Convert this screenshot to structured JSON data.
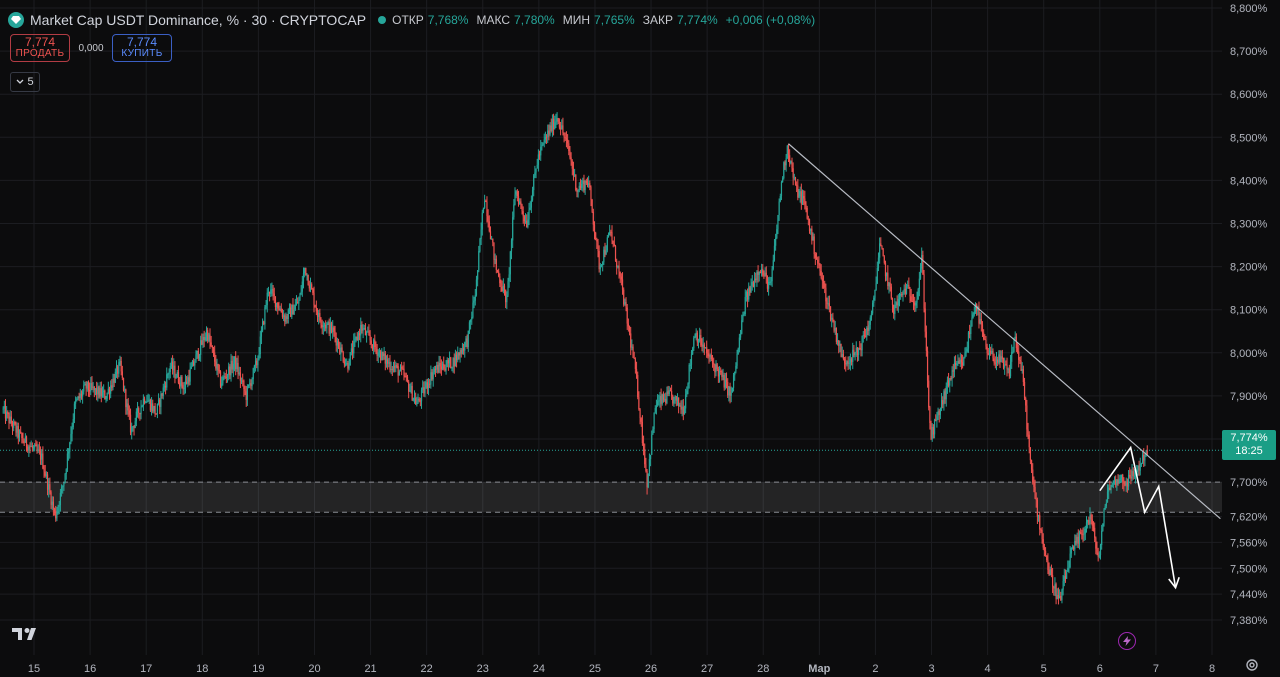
{
  "header": {
    "title": "Market Cap USDT Dominance, % · 30 · CRYPTOCAP",
    "ohlc": [
      {
        "label": "ОТКР",
        "value": "7,768%"
      },
      {
        "label": "МАКС",
        "value": "7,780%"
      },
      {
        "label": "МИН",
        "value": "7,765%"
      },
      {
        "label": "ЗАКР",
        "value": "7,774%"
      }
    ],
    "change": "+0,006 (+0,08%)"
  },
  "trade": {
    "sell_price": "7,774",
    "sell_label": "ПРОДАТЬ",
    "spread": "0,000",
    "buy_price": "7,774",
    "buy_label": "КУПИТЬ"
  },
  "indicators_toggle": {
    "count": "5"
  },
  "price_tag": {
    "value": "7,774%",
    "countdown": "18:25"
  },
  "colors": {
    "background": "#0c0c0d",
    "up": "#26a69a",
    "down": "#ef5350",
    "grid": "#1c1d21",
    "axis_text": "#b2b5be"
  },
  "icons": {
    "logo": "diamond-icon",
    "tradingview": "tradingview-logo",
    "replay": "bolt-icon",
    "settings": "gear-icon"
  },
  "chart_data": {
    "type": "candlestick",
    "title": "Market Cap USDT Dominance, % · 30 · CRYPTOCAP",
    "xlabel": "",
    "ylabel": "",
    "ylim": [
      7.3,
      8.81
    ],
    "grid": true,
    "y_ticks": [
      "8,800%",
      "8,700%",
      "8,600%",
      "8,500%",
      "8,400%",
      "8,300%",
      "8,200%",
      "8,100%",
      "8,000%",
      "7,900%",
      "7,800%",
      "7,700%",
      "7,620%",
      "7,560%",
      "7,500%",
      "7,440%",
      "7,380%"
    ],
    "y_tick_values": [
      8.8,
      8.7,
      8.6,
      8.5,
      8.4,
      8.3,
      8.2,
      8.1,
      8.0,
      7.9,
      7.8,
      7.7,
      7.62,
      7.56,
      7.5,
      7.44,
      7.38
    ],
    "x_ticks": [
      "15",
      "16",
      "17",
      "18",
      "19",
      "20",
      "21",
      "22",
      "23",
      "24",
      "25",
      "26",
      "27",
      "28",
      "Мар",
      "2",
      "3",
      "4",
      "5",
      "6",
      "7",
      "8"
    ],
    "x_tick_index": [
      0,
      1,
      2,
      3,
      4,
      5,
      6,
      7,
      8,
      9,
      10,
      11,
      12,
      13,
      14,
      15,
      16,
      17,
      18,
      19,
      20,
      21
    ],
    "x_range_days": [
      -0.55,
      21.15
    ],
    "price_anchors": [
      [
        -0.55,
        7.87
      ],
      [
        -0.2,
        7.8
      ],
      [
        0.15,
        7.76
      ],
      [
        0.4,
        7.62
      ],
      [
        0.55,
        7.7
      ],
      [
        0.75,
        7.88
      ],
      [
        0.95,
        7.92
      ],
      [
        1.3,
        7.9
      ],
      [
        1.55,
        7.97
      ],
      [
        1.75,
        7.82
      ],
      [
        2.0,
        7.9
      ],
      [
        2.2,
        7.86
      ],
      [
        2.45,
        7.97
      ],
      [
        2.7,
        7.92
      ],
      [
        3.1,
        8.05
      ],
      [
        3.35,
        7.93
      ],
      [
        3.6,
        7.98
      ],
      [
        3.8,
        7.9
      ],
      [
        4.0,
        7.98
      ],
      [
        4.2,
        8.15
      ],
      [
        4.5,
        8.08
      ],
      [
        4.75,
        8.12
      ],
      [
        4.85,
        8.2
      ],
      [
        5.1,
        8.08
      ],
      [
        5.35,
        8.05
      ],
      [
        5.6,
        7.97
      ],
      [
        5.85,
        8.06
      ],
      [
        6.05,
        8.02
      ],
      [
        6.3,
        7.98
      ],
      [
        6.6,
        7.95
      ],
      [
        6.85,
        7.88
      ],
      [
        7.15,
        7.96
      ],
      [
        7.5,
        7.98
      ],
      [
        7.75,
        8.03
      ],
      [
        7.9,
        8.15
      ],
      [
        8.05,
        8.37
      ],
      [
        8.25,
        8.2
      ],
      [
        8.45,
        8.12
      ],
      [
        8.6,
        8.38
      ],
      [
        8.8,
        8.3
      ],
      [
        9.0,
        8.45
      ],
      [
        9.15,
        8.5
      ],
      [
        9.35,
        8.55
      ],
      [
        9.55,
        8.47
      ],
      [
        9.7,
        8.38
      ],
      [
        9.9,
        8.4
      ],
      [
        10.1,
        8.2
      ],
      [
        10.3,
        8.28
      ],
      [
        10.5,
        8.15
      ],
      [
        10.75,
        7.95
      ],
      [
        10.95,
        7.7
      ],
      [
        11.1,
        7.88
      ],
      [
        11.35,
        7.9
      ],
      [
        11.6,
        7.87
      ],
      [
        11.8,
        8.05
      ],
      [
        12.0,
        8.0
      ],
      [
        12.25,
        7.95
      ],
      [
        12.45,
        7.9
      ],
      [
        12.7,
        8.12
      ],
      [
        12.95,
        8.2
      ],
      [
        13.15,
        8.15
      ],
      [
        13.35,
        8.4
      ],
      [
        13.45,
        8.48
      ],
      [
        13.6,
        8.38
      ],
      [
        13.75,
        8.35
      ],
      [
        13.95,
        8.23
      ],
      [
        14.2,
        8.1
      ],
      [
        14.45,
        7.98
      ],
      [
        14.7,
        8.0
      ],
      [
        14.95,
        8.08
      ],
      [
        15.1,
        8.25
      ],
      [
        15.35,
        8.1
      ],
      [
        15.55,
        8.15
      ],
      [
        15.75,
        8.12
      ],
      [
        15.85,
        8.22
      ],
      [
        16.0,
        7.8
      ],
      [
        16.15,
        7.86
      ],
      [
        16.4,
        7.96
      ],
      [
        16.6,
        7.98
      ],
      [
        16.8,
        8.12
      ],
      [
        17.0,
        8.0
      ],
      [
        17.25,
        7.98
      ],
      [
        17.4,
        7.95
      ],
      [
        17.5,
        8.04
      ],
      [
        17.65,
        7.94
      ],
      [
        17.8,
        7.72
      ],
      [
        17.95,
        7.6
      ],
      [
        18.1,
        7.5
      ],
      [
        18.3,
        7.42
      ],
      [
        18.5,
        7.53
      ],
      [
        18.7,
        7.58
      ],
      [
        18.85,
        7.62
      ],
      [
        19.0,
        7.52
      ],
      [
        19.15,
        7.68
      ],
      [
        19.35,
        7.71
      ],
      [
        19.5,
        7.7
      ],
      [
        19.7,
        7.73
      ],
      [
        19.85,
        7.774
      ]
    ],
    "trendline": {
      "from": [
        13.45,
        8.485
      ],
      "to": [
        21.15,
        7.615
      ]
    },
    "current_price_line": 7.774,
    "support_zone": [
      7.63,
      7.7
    ],
    "projection_path": [
      [
        19.0,
        7.68
      ],
      [
        19.55,
        7.78
      ],
      [
        19.8,
        7.63
      ],
      [
        20.05,
        7.69
      ],
      [
        20.35,
        7.455
      ]
    ]
  }
}
